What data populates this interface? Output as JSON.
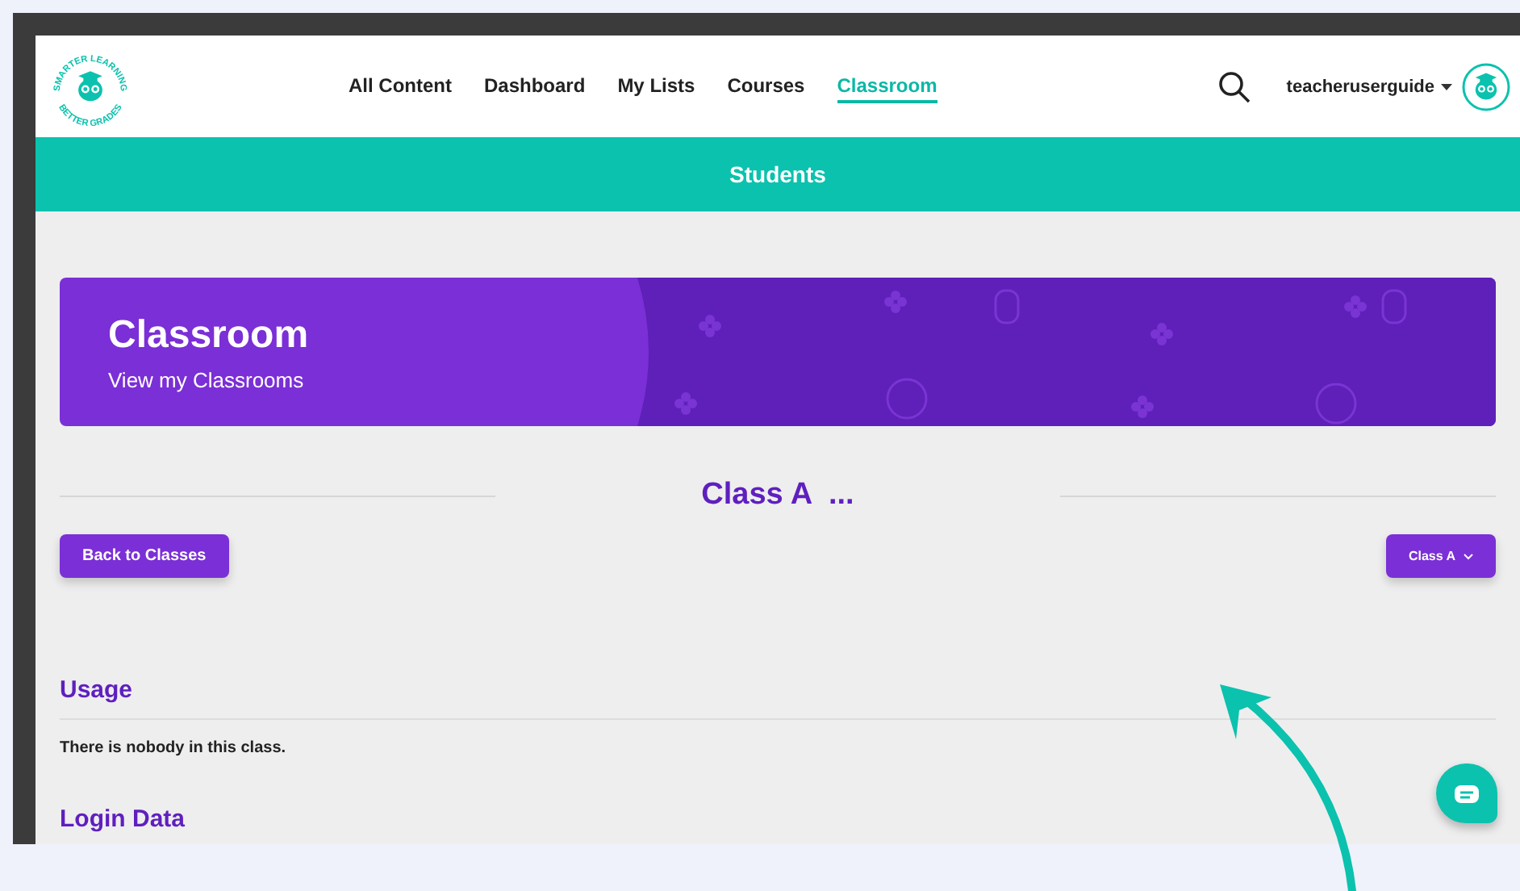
{
  "logo": {
    "top_text": "SMARTER LEARNING",
    "bottom_text": "BETTER GRADES"
  },
  "nav": [
    {
      "label": "All Content",
      "selected": false
    },
    {
      "label": "Dashboard",
      "selected": false
    },
    {
      "label": "My Lists",
      "selected": false
    },
    {
      "label": "Courses",
      "selected": false
    },
    {
      "label": "Classroom",
      "selected": true
    }
  ],
  "user": {
    "name": "teacheruserguide"
  },
  "page_bar": {
    "title": "Students"
  },
  "banner": {
    "title": "Classroom",
    "subtitle": "View my Classrooms"
  },
  "class_heading": "Class A  ...",
  "back_button": "Back to Classes",
  "class_select": {
    "value": "Class A"
  },
  "sections": [
    {
      "title": "Usage",
      "message": "There is nobody in this class."
    },
    {
      "title": "Login Data"
    }
  ]
}
